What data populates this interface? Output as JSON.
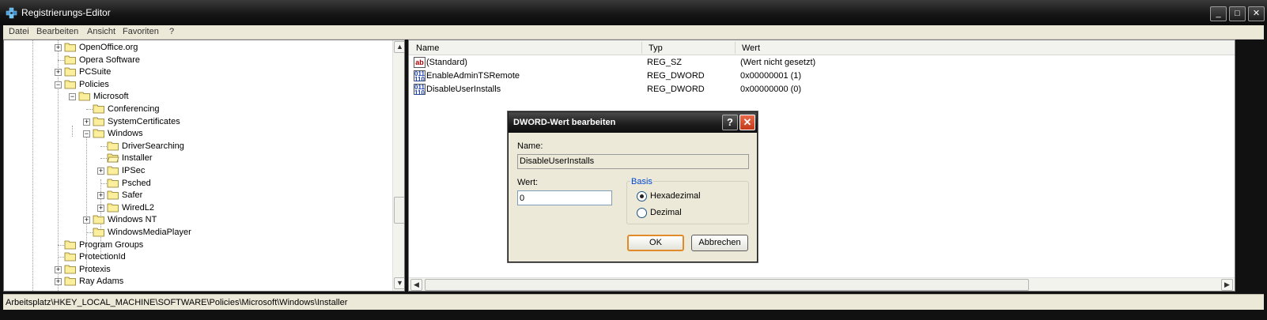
{
  "window": {
    "title": "Registrierungs-Editor"
  },
  "menu": [
    "Datei",
    "Bearbeiten",
    "Ansicht",
    "Favoriten",
    "?"
  ],
  "tree": {
    "items": [
      {
        "label": "OpenOffice.org",
        "level": 0,
        "expander": "+"
      },
      {
        "label": "Opera Software",
        "level": 0,
        "expander": ""
      },
      {
        "label": "PCSuite",
        "level": 0,
        "expander": "+"
      },
      {
        "label": "Policies",
        "level": 0,
        "expander": "-"
      },
      {
        "label": "Microsoft",
        "level": 1,
        "expander": "-"
      },
      {
        "label": "Conferencing",
        "level": 2,
        "expander": ""
      },
      {
        "label": "SystemCertificates",
        "level": 2,
        "expander": "+"
      },
      {
        "label": "Windows",
        "level": 2,
        "expander": "-"
      },
      {
        "label": "DriverSearching",
        "level": 3,
        "expander": ""
      },
      {
        "label": "Installer",
        "level": 3,
        "expander": "",
        "selected_open": true
      },
      {
        "label": "IPSec",
        "level": 3,
        "expander": "+"
      },
      {
        "label": "Psched",
        "level": 3,
        "expander": ""
      },
      {
        "label": "Safer",
        "level": 3,
        "expander": "+"
      },
      {
        "label": "WiredL2",
        "level": 3,
        "expander": "+"
      },
      {
        "label": "Windows NT",
        "level": 2,
        "expander": "+"
      },
      {
        "label": "WindowsMediaPlayer",
        "level": 2,
        "expander": ""
      },
      {
        "label": "Program Groups",
        "level": 0,
        "expander": ""
      },
      {
        "label": "ProtectionId",
        "level": 0,
        "expander": ""
      },
      {
        "label": "Protexis",
        "level": 0,
        "expander": "+"
      },
      {
        "label": "Ray Adams",
        "level": 0,
        "expander": "+"
      }
    ]
  },
  "values": {
    "columns": {
      "name": "Name",
      "type": "Typ",
      "value": "Wert"
    },
    "rows": [
      {
        "icon": "string-value-icon",
        "name": "(Standard)",
        "type": "REG_SZ",
        "value": "(Wert nicht gesetzt)"
      },
      {
        "icon": "dword-value-icon",
        "name": "EnableAdminTSRemote",
        "type": "REG_DWORD",
        "value": "0x00000001 (1)"
      },
      {
        "icon": "dword-value-icon",
        "name": "DisableUserInstalls",
        "type": "REG_DWORD",
        "value": "0x00000000 (0)"
      }
    ]
  },
  "status": {
    "path": "Arbeitsplatz\\HKEY_LOCAL_MACHINE\\SOFTWARE\\Policies\\Microsoft\\Windows\\Installer"
  },
  "dialog": {
    "title": "DWORD-Wert bearbeiten",
    "name_label": "Name:",
    "name_value": "DisableUserInstalls",
    "value_label": "Wert:",
    "value": "0",
    "basis_label": "Basis",
    "radio_hex": "Hexadezimal",
    "radio_dec": "Dezimal",
    "selected_basis": "hex",
    "ok": "OK",
    "cancel": "Abbrechen",
    "help_glyph": "?",
    "close_glyph": "✕"
  },
  "titlebar_buttons": {
    "minimize": "_",
    "maximize": "□",
    "close": "✕"
  },
  "colors": {
    "title_bg": "#141414",
    "menu_bg": "#ece9d8",
    "accent_blue": "#0046d5",
    "close_red": "#c23a1a"
  }
}
